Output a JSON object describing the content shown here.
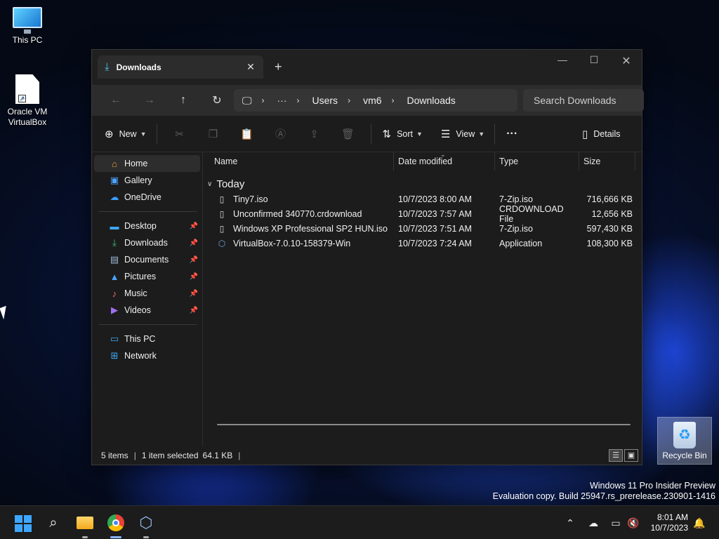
{
  "desktop": {
    "icons": [
      {
        "label": "This PC",
        "icon": "monitor-icon"
      },
      {
        "label": "Oracle VM\nVirtualBox",
        "icon": "shortcut-file-icon"
      }
    ],
    "recycle_bin": "Recycle Bin",
    "watermark": {
      "line1": "Windows 11 Pro Insider Preview",
      "line2": "Evaluation copy. Build 25947.rs_prerelease.230901-1416"
    }
  },
  "window": {
    "tab_title": "Downloads",
    "tab_close": "✕",
    "new_tab": "+",
    "controls": {
      "minimize": "—",
      "maximize": "☐",
      "close": "✕"
    },
    "nav": {
      "back": "←",
      "forward": "→",
      "up": "↑",
      "refresh": "↻"
    },
    "address": {
      "pc_icon": "🖵",
      "ellipsis": "···",
      "crumbs": [
        "Users",
        "vm6",
        "Downloads"
      ],
      "separator": "›"
    },
    "search_placeholder": "Search Downloads",
    "commandbar": {
      "new": "New",
      "sort": "Sort",
      "view": "View",
      "more": "···",
      "details": "Details"
    },
    "sidebar": {
      "group1": [
        {
          "label": "Home",
          "icon": "home-icon",
          "selected": true
        },
        {
          "label": "Gallery",
          "icon": "gallery-icon"
        },
        {
          "label": "OneDrive",
          "icon": "cloud-icon"
        }
      ],
      "group2": [
        {
          "label": "Desktop",
          "icon": "desktop-icon",
          "pinned": true
        },
        {
          "label": "Downloads",
          "icon": "download-icon",
          "pinned": true
        },
        {
          "label": "Documents",
          "icon": "documents-icon",
          "pinned": true
        },
        {
          "label": "Pictures",
          "icon": "pictures-icon",
          "pinned": true
        },
        {
          "label": "Music",
          "icon": "music-icon",
          "pinned": true
        },
        {
          "label": "Videos",
          "icon": "videos-icon",
          "pinned": true
        }
      ],
      "group3": [
        {
          "label": "This PC",
          "icon": "pc-icon"
        },
        {
          "label": "Network",
          "icon": "network-icon"
        }
      ]
    },
    "columns": [
      "Name",
      "Date modified",
      "Type",
      "Size"
    ],
    "group_label": "Today",
    "files": [
      {
        "name": "Tiny7.iso",
        "date": "10/7/2023 8:00 AM",
        "type": "7-Zip.iso",
        "size": "716,666 KB",
        "icon": "file-icon"
      },
      {
        "name": "Unconfirmed 340770.crdownload",
        "date": "10/7/2023 7:57 AM",
        "type": "CRDOWNLOAD File",
        "size": "12,656 KB",
        "icon": "file-icon"
      },
      {
        "name": "Windows XP Professional SP2 HUN.iso",
        "date": "10/7/2023 7:51 AM",
        "type": "7-Zip.iso",
        "size": "597,430 KB",
        "icon": "file-icon"
      },
      {
        "name": "VirtualBox-7.0.10-158379-Win",
        "date": "10/7/2023 7:24 AM",
        "type": "Application",
        "size": "108,300 KB",
        "icon": "virtualbox-icon"
      }
    ],
    "status": {
      "items": "5 items",
      "selected": "1 item selected",
      "size": "64.1 KB",
      "bar": "|"
    }
  },
  "taskbar": {
    "clock_time": "8:01 AM",
    "clock_date": "10/7/2023"
  }
}
